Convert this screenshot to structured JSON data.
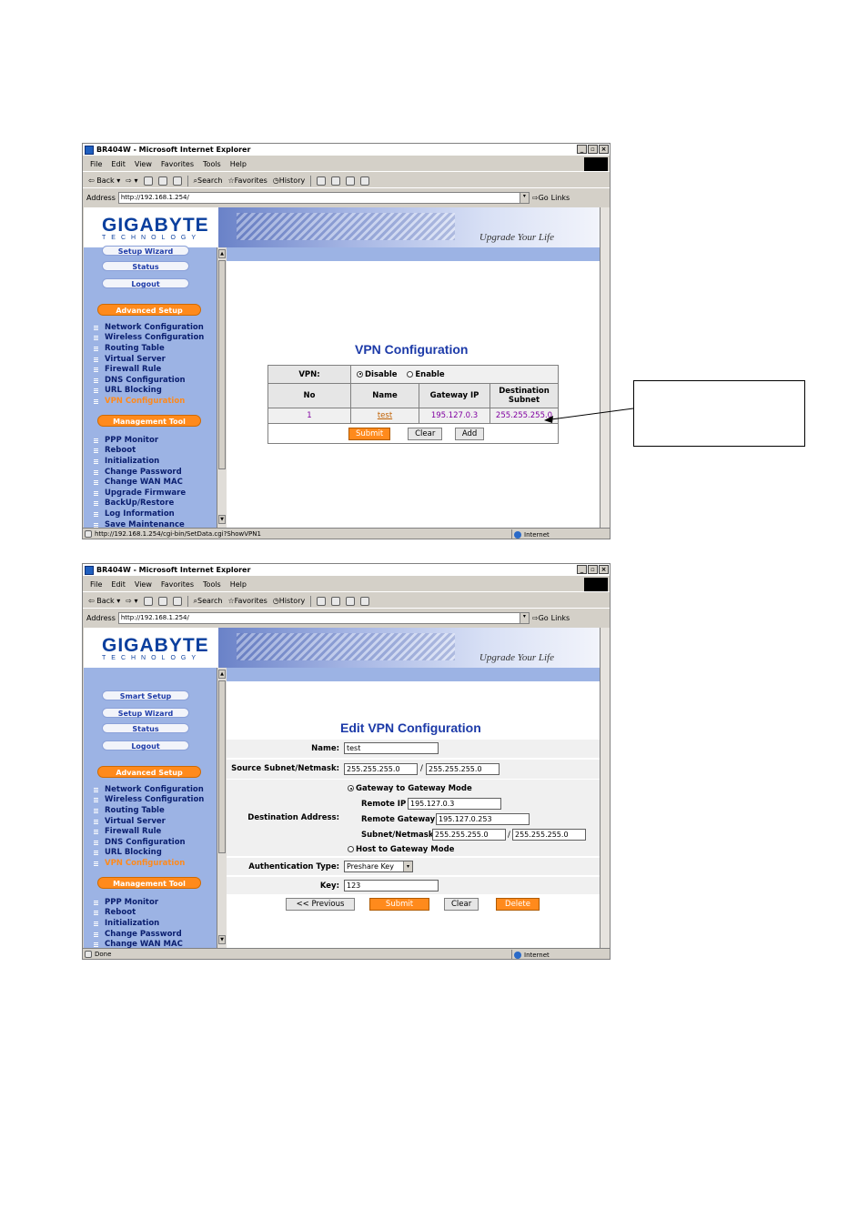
{
  "browser": {
    "title": "BR404W - Microsoft Internet Explorer",
    "menu": [
      "File",
      "Edit",
      "View",
      "Favorites",
      "Tools",
      "Help"
    ],
    "toolbar": {
      "back": "Back",
      "search": "Search",
      "favorites": "Favorites",
      "history": "History"
    },
    "address_label": "Address",
    "address_url": "http://192.168.1.254/",
    "go": "Go",
    "links": "Links"
  },
  "brand": {
    "logo": "GIGABYTE",
    "tech": "TECHNOLOGY",
    "slogan": "Upgrade Your Life"
  },
  "sidebar": {
    "smart_setup": "Smart Setup",
    "setup_wizard": "Setup Wizard",
    "status": "Status",
    "logout": "Logout",
    "advanced_setup": "Advanced Setup",
    "management_tool": "Management Tool",
    "advanced_items": [
      "Network Configuration",
      "Wireless Configuration",
      "Routing Table",
      "Virtual Server",
      "Firewall Rule",
      "DNS Configuration",
      "URL Blocking",
      "VPN Configuration"
    ],
    "management_items": [
      "PPP Monitor",
      "Reboot",
      "Initialization",
      "Change Password",
      "Change WAN MAC",
      "Upgrade Firmware",
      "BackUp/Restore",
      "Log Information",
      "Save Maintenance"
    ],
    "management_items_short": [
      "PPP Monitor",
      "Reboot",
      "Initialization",
      "Change Password",
      "Change WAN MAC"
    ]
  },
  "vpn": {
    "title": "VPN Configuration",
    "vpn_label": "VPN:",
    "disable": "Disable",
    "enable": "Enable",
    "headers": {
      "no": "No",
      "name": "Name",
      "gateway": "Gateway IP",
      "dest1": "Destination",
      "dest2": "Subnet"
    },
    "row": {
      "no": "1",
      "name": "test",
      "gateway": "195.127.0.3",
      "subnet": "255.255.255.0"
    },
    "submit": "Submit",
    "clear": "Clear",
    "add": "Add",
    "status_url": "http://192.168.1.254/cgi-bin/SetData.cgi?ShowVPN1",
    "zone": "Internet"
  },
  "edit": {
    "title": "Edit VPN Configuration",
    "name_label": "Name:",
    "name_value": "test",
    "source_label": "Source Subnet/Netmask:",
    "source_subnet": "255.255.255.0",
    "source_netmask": "255.255.255.0",
    "dest_label": "Destination Address:",
    "g2g": "Gateway to Gateway Mode",
    "remote_ip_label": "Remote IP",
    "remote_ip": "195.127.0.3",
    "remote_gw_label": "Remote Gateway",
    "remote_gw": "195.127.0.253",
    "subnet_label": "Subnet/Netmask",
    "subnet_value": "255.255.255.0",
    "netmask_value": "255.255.255.0",
    "h2g": "Host to Gateway Mode",
    "auth_label": "Authentication Type:",
    "auth_value": "Preshare Key",
    "key_label": "Key:",
    "key_value": "123",
    "previous": "<< Previous",
    "submit": "Submit",
    "clear": "Clear",
    "delete": "Delete",
    "status": "Done",
    "zone": "Internet"
  }
}
